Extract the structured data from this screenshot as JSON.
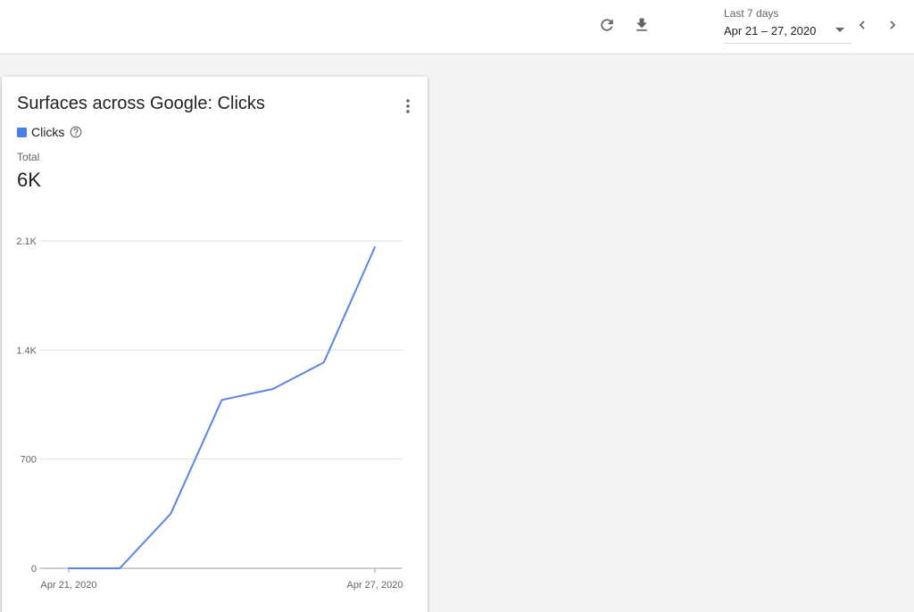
{
  "toolbar": {
    "refresh_icon": "refresh-icon",
    "download_icon": "download-icon"
  },
  "date_range": {
    "label": "Last 7 days",
    "value": "Apr 21 – 27, 2020",
    "prev_icon": "chevron-left-icon",
    "next_icon": "chevron-right-icon"
  },
  "card": {
    "title": "Surfaces across Google: Clicks",
    "legend_label": "Clicks",
    "legend_color": "#4a7de6",
    "total_label": "Total",
    "total_value": "6K"
  },
  "chart_data": {
    "type": "line",
    "x": [
      "Apr 21, 2020",
      "Apr 22, 2020",
      "Apr 23, 2020",
      "Apr 24, 2020",
      "Apr 25, 2020",
      "Apr 26, 2020",
      "Apr 27, 2020"
    ],
    "x_tick_labels": [
      "Apr 21, 2020",
      "Apr 27, 2020"
    ],
    "series": [
      {
        "name": "Clicks",
        "color": "#5b84e7",
        "values": [
          0,
          0,
          350,
          1080,
          1150,
          1320,
          2060
        ]
      }
    ],
    "y_ticks": [
      0,
      700,
      1400,
      2100
    ],
    "y_tick_labels": [
      "0",
      "700",
      "1.4K",
      "2.1K"
    ],
    "ylim": [
      0,
      2100
    ],
    "grid": true
  }
}
